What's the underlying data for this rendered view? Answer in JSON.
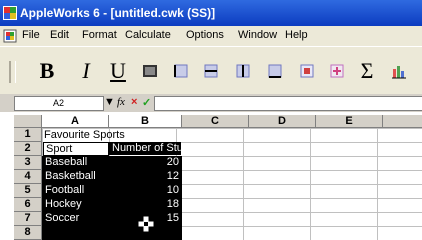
{
  "window": {
    "title": "AppleWorks 6 - [untitled.cwk (SS)]"
  },
  "menu": [
    "File",
    "Edit",
    "Format",
    "Calculate",
    "Options",
    "Window",
    "Help"
  ],
  "toolbar": {
    "bold": "B",
    "italic": "I",
    "underline": "U",
    "icons": [
      "fill-icon",
      "borders-left-icon",
      "borders-center-icon",
      "borders-right-icon",
      "borders-bottom-icon",
      "merge-icon",
      "sort-icon",
      "sum-icon",
      "chart-icon"
    ]
  },
  "formula_bar": {
    "cell_ref": "A2",
    "fx": "fx",
    "cancel": "×",
    "accept": "✓",
    "value": ""
  },
  "sheet": {
    "columns": [
      "A",
      "B",
      "C",
      "D",
      "E"
    ],
    "rows": [
      "1",
      "2",
      "3",
      "4",
      "5",
      "6",
      "7",
      "8"
    ],
    "cells": {
      "a1": "Favourite Sports",
      "a2": "Sport",
      "b2": "Number of Students",
      "a3": "Baseball",
      "b3": "20",
      "a4": "Basketball",
      "b4": "12",
      "a5": "Football",
      "b5": "10",
      "a6": "Hockey",
      "b6": "18",
      "a7": "Soccer",
      "b7": "15"
    }
  }
}
